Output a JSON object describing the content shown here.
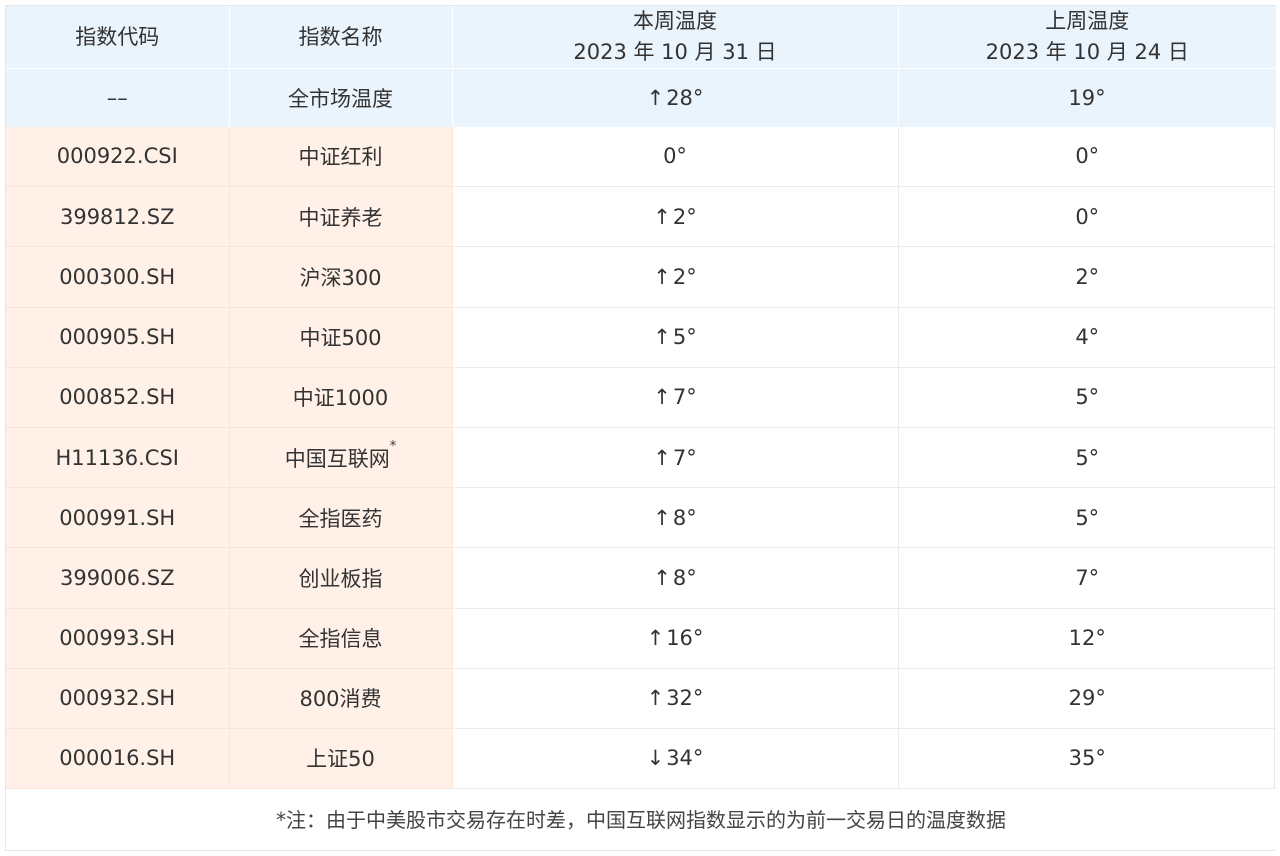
{
  "header": {
    "col_code": "指数代码",
    "col_name": "指数名称",
    "col_this_week": "本周温度",
    "col_this_week_date": "2023 年 10 月 31 日",
    "col_last_week": "上周温度",
    "col_last_week_date": "2023 年 10 月 24 日"
  },
  "summary": {
    "code": "––",
    "name": "全市场温度",
    "this_week_arrow": "↑",
    "this_week": "28°",
    "last_week": "19°"
  },
  "rows": [
    {
      "code": "000922.CSI",
      "name": "中证红利",
      "star": "",
      "arrow": "",
      "this_week": "0°",
      "last_week": "0°"
    },
    {
      "code": "399812.SZ",
      "name": "中证养老",
      "star": "",
      "arrow": "↑",
      "this_week": "2°",
      "last_week": "0°"
    },
    {
      "code": "000300.SH",
      "name": "沪深300",
      "star": "",
      "arrow": "↑",
      "this_week": "2°",
      "last_week": "2°"
    },
    {
      "code": "000905.SH",
      "name": "中证500",
      "star": "",
      "arrow": "↑",
      "this_week": "5°",
      "last_week": "4°"
    },
    {
      "code": "000852.SH",
      "name": "中证1000",
      "star": "",
      "arrow": "↑",
      "this_week": "7°",
      "last_week": "5°"
    },
    {
      "code": "H11136.CSI",
      "name": "中国互联网",
      "star": "*",
      "arrow": "↑",
      "this_week": "7°",
      "last_week": "5°"
    },
    {
      "code": "000991.SH",
      "name": "全指医药",
      "star": "",
      "arrow": "↑",
      "this_week": "8°",
      "last_week": "5°"
    },
    {
      "code": "399006.SZ",
      "name": "创业板指",
      "star": "",
      "arrow": "↑",
      "this_week": "8°",
      "last_week": "7°"
    },
    {
      "code": "000993.SH",
      "name": "全指信息",
      "star": "",
      "arrow": "↑",
      "this_week": "16°",
      "last_week": "12°"
    },
    {
      "code": "000932.SH",
      "name": "800消费",
      "star": "",
      "arrow": "↑",
      "this_week": "32°",
      "last_week": "29°"
    },
    {
      "code": "000016.SH",
      "name": "上证50",
      "star": "",
      "arrow": "↓",
      "this_week": "34°",
      "last_week": "35°"
    }
  ],
  "footer": {
    "note": "*注：由于中美股市交易存在时差，中国互联网指数显示的为前一交易日的温度数据"
  }
}
